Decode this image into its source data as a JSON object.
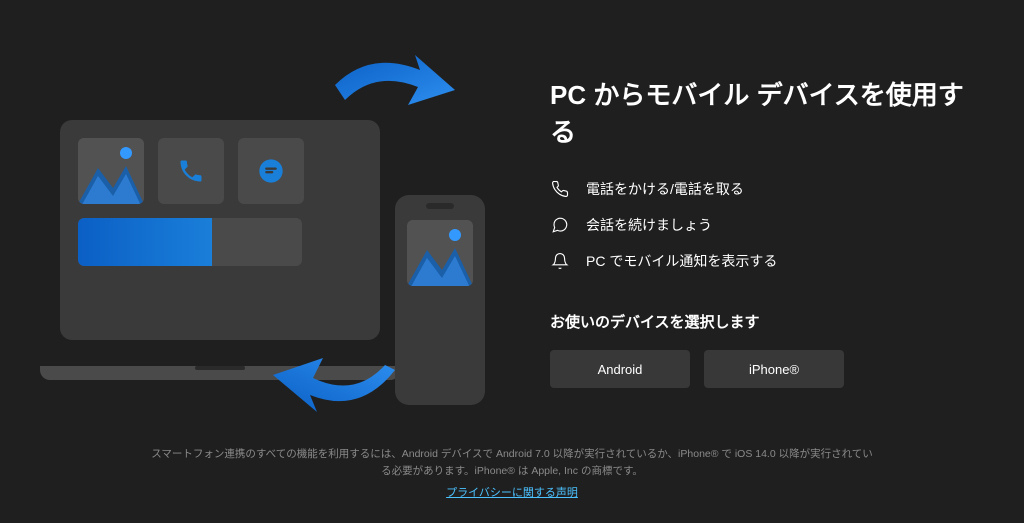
{
  "heading": "PC からモバイル デバイスを使用する",
  "features": [
    {
      "icon": "phone-icon",
      "text": "電話をかける/電話を取る"
    },
    {
      "icon": "chat-icon",
      "text": "会話を続けましょう"
    },
    {
      "icon": "bell-icon",
      "text": "PC でモバイル通知を表示する"
    }
  ],
  "subheading": "お使いのデバイスを選択します",
  "buttons": {
    "android": "Android",
    "iphone": "iPhone®"
  },
  "footer": {
    "requirements": "スマートフォン連携のすべての機能を利用するには、Android デバイスで Android 7.0 以降が実行されているか、iPhone® で iOS 14.0 以降が実行されている必要があります。iPhone® は Apple, Inc の商標です。",
    "privacy_link": "プライバシーに関する声明"
  },
  "colors": {
    "accent_blue": "#1a7fd9",
    "accent_blue_dark": "#0b5fc5",
    "link": "#4cc2ff"
  }
}
